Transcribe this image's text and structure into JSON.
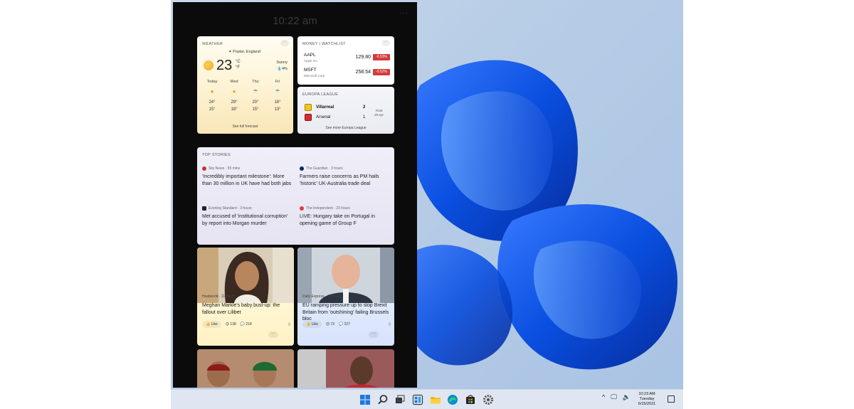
{
  "panel": {
    "time": "10:22 am",
    "more": "···"
  },
  "weather": {
    "title": "WEATHER",
    "location": "Poplar, England",
    "temp": "23",
    "unit_c": "°C",
    "unit_f": "°F",
    "condition": "Sunny",
    "precip": "4%",
    "days": [
      {
        "day": "Today",
        "hi": "24°",
        "lo": "15°",
        "icon": "sun-icon"
      },
      {
        "day": "Wed",
        "hi": "29°",
        "lo": "18°",
        "icon": "sun-icon"
      },
      {
        "day": "Thu",
        "hi": "20°",
        "lo": "15°",
        "icon": "rain-icon"
      },
      {
        "day": "Fri",
        "hi": "16°",
        "lo": "13°",
        "icon": "rain-icon"
      }
    ],
    "link": "See full forecast"
  },
  "money": {
    "title": "MONEY | WATCHLIST",
    "stocks": [
      {
        "symbol": "AAPL",
        "name": "Apple Inc",
        "price": "129.80",
        "change": "-0.53%"
      },
      {
        "symbol": "MSFT",
        "name": "Microsoft Corp",
        "price": "258.54",
        "change": "-0.52%"
      }
    ]
  },
  "europa": {
    "title": "EUROPA LEAGUE",
    "home": "Villarreal",
    "home_score": "2",
    "away": "Arsenal",
    "away_score": "1",
    "status": "Final",
    "date": "29 Apr",
    "link": "See more Europa League"
  },
  "top_stories": {
    "title": "TOP STORIES",
    "items": [
      {
        "source": "Sky News · 55 mins",
        "title": "'Incredibly important milestone': More than 30 million in UK have had both jabs"
      },
      {
        "source": "The Guardian · 3 hours",
        "title": "Farmers raise concerns as PM hails 'historic' UK-Australia trade deal"
      },
      {
        "source": "Evening Standard · 3 hours",
        "title": "Met accused of 'institutional corruption' by report into Morgan murder"
      },
      {
        "source": "The Independent · 23 hours",
        "title": "LIVE: Hungary take on Portugal in opening game of Group F"
      }
    ]
  },
  "cards": [
    {
      "source": "Heatworld · 11 hours",
      "title": "Meghan Markle's baby bust-up: the fallout over Lilibet",
      "like": "Like",
      "reactions": "138",
      "comments": "218"
    },
    {
      "source": "Daily Express · 11 hours",
      "title": "EU ramping pressure up to stop Brexit Britain from 'outshining' failing Brussels bloc",
      "like": "Like",
      "reactions": "73",
      "comments": "227"
    }
  ],
  "taskbar": {
    "time": "10:23 AM",
    "day": "Tuesday",
    "date": "6/15/2021"
  },
  "colors": {
    "accent": "#0067c0",
    "loss": "#d43b3b"
  }
}
